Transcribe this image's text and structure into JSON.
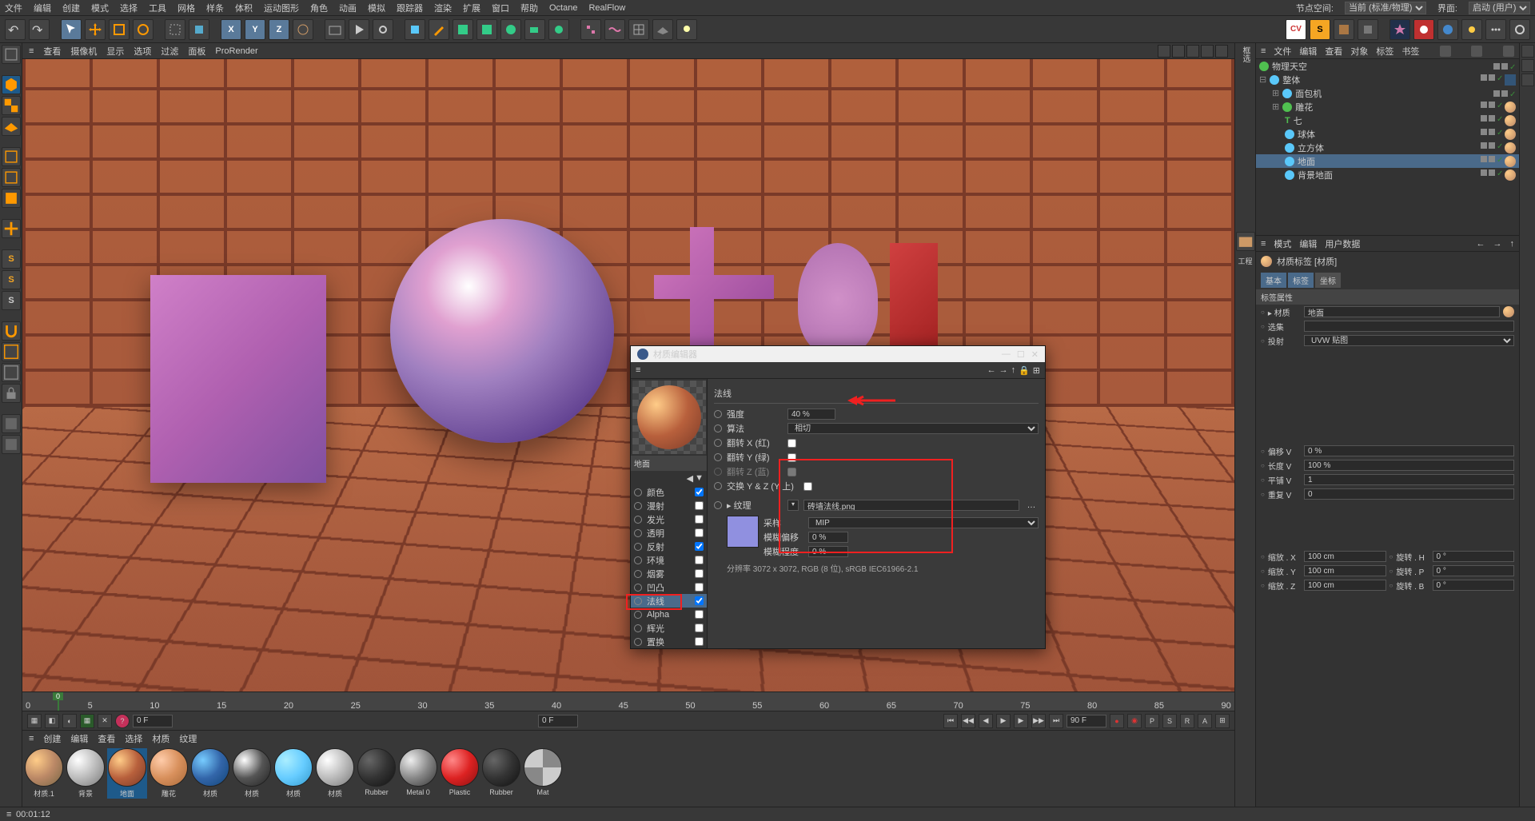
{
  "menubar": [
    "文件",
    "编辑",
    "创建",
    "模式",
    "选择",
    "工具",
    "网格",
    "样条",
    "体积",
    "运动图形",
    "角色",
    "动画",
    "模拟",
    "跟踪器",
    "渲染",
    "扩展",
    "窗口",
    "帮助",
    "Octane",
    "RealFlow"
  ],
  "menubar_right": {
    "node_space": "节点空间:",
    "node_space_val": "当前 (标准/物理)",
    "layout": "界面:",
    "layout_val": "启动 (用户)"
  },
  "vp_menu": [
    "≡",
    "查看",
    "摄像机",
    "显示",
    "选项",
    "过滤",
    "面板",
    "ProRender"
  ],
  "timeline": {
    "ticks": [
      "0",
      "5",
      "10",
      "15",
      "20",
      "25",
      "30",
      "35",
      "40",
      "45",
      "50",
      "55",
      "60",
      "65",
      "70",
      "75",
      "80",
      "85",
      "90"
    ]
  },
  "transport": {
    "start": "0 F",
    "cur": "0 F",
    "end": "90 F"
  },
  "mat_menu": [
    "≡",
    "创建",
    "编辑",
    "查看",
    "选择",
    "材质",
    "纹理"
  ],
  "materials": [
    {
      "name": "材质.1",
      "grad": "radial-gradient(circle at 30% 30%,#fc8,#b86,#764)"
    },
    {
      "name": "背景",
      "grad": "radial-gradient(circle at 30% 30%,#fff,#bbb,#777)"
    },
    {
      "name": "地面",
      "grad": "radial-gradient(circle at 30% 30%,#fc8,#b8603c,#7a3a28)",
      "sel": true
    },
    {
      "name": "雕花",
      "grad": "radial-gradient(circle at 30% 30%,#fca,#d8905c,#a86838)"
    },
    {
      "name": "材质",
      "grad": "radial-gradient(circle at 30% 30%,#7cf,#36a,#147)"
    },
    {
      "name": "材质",
      "grad": "radial-gradient(circle at 30% 30%,#fff,#555,#222)"
    },
    {
      "name": "材质",
      "grad": "radial-gradient(circle at 30% 30%,#aef,#6cf,#39c)"
    },
    {
      "name": "材质",
      "grad": "radial-gradient(circle at 30% 30%,#fff,#bbb,#777)"
    },
    {
      "name": "Rubber",
      "grad": "radial-gradient(circle at 30% 30%,#666,#333,#111)"
    },
    {
      "name": "Metal 0",
      "grad": "radial-gradient(circle at 30% 30%,#eee,#888,#333)"
    },
    {
      "name": "Plastic",
      "grad": "radial-gradient(circle at 30% 30%,#f88,#d22,#811)"
    },
    {
      "name": "Rubber",
      "grad": "radial-gradient(circle at 30% 30%,#666,#333,#111)"
    },
    {
      "name": "Mat",
      "grad": "repeating-conic-gradient(#888 0 25%,#ccc 0 50%)"
    }
  ],
  "objects_tabs": [
    "≡",
    "文件",
    "编辑",
    "查看",
    "对象",
    "标签",
    "书签"
  ],
  "tree": [
    {
      "ind": 0,
      "icon": "grn",
      "label": "物理天空",
      "tags": [
        "chk"
      ]
    },
    {
      "ind": 0,
      "icon": "blu",
      "label": "整体",
      "tags": [
        "chk",
        "spacer",
        "sq"
      ],
      "pre": "⊟ "
    },
    {
      "ind": 1,
      "icon": "blu",
      "label": "面包机",
      "tags": [
        "chk"
      ],
      "pre": "⊞ "
    },
    {
      "ind": 1,
      "icon": "grn",
      "label": "雕花",
      "tags": [
        "chk",
        "sph"
      ],
      "pre": "⊞ "
    },
    {
      "ind": 2,
      "icon": "txt",
      "label": "七",
      "tags": [
        "chk",
        "sph"
      ],
      "txt": "T"
    },
    {
      "ind": 2,
      "icon": "blu",
      "label": "球体",
      "tags": [
        "chk",
        "sph"
      ]
    },
    {
      "ind": 2,
      "icon": "blu",
      "label": "立方体",
      "tags": [
        "chk",
        "sph"
      ]
    },
    {
      "ind": 2,
      "icon": "blu",
      "label": "地面",
      "tags": [
        "chk",
        "sph2"
      ],
      "sel": true
    },
    {
      "ind": 2,
      "icon": "blu",
      "label": "背景地面",
      "tags": [
        "chk",
        "sph2"
      ]
    }
  ],
  "side_label": "框选",
  "project_label": "工程",
  "attr_head": [
    "≡",
    "模式",
    "编辑",
    "用户数据"
  ],
  "attr_title": "材质标签 [材质]",
  "attr_tabs": [
    {
      "l": "基本",
      "on": true
    },
    {
      "l": "标签",
      "on": true
    },
    {
      "l": "坐标",
      "on": false
    }
  ],
  "attr_section": "标签属性",
  "attr_rows": [
    {
      "l": "▸ 材质",
      "v": "地面",
      "trail": "ball"
    },
    {
      "l": "选集",
      "v": ""
    },
    {
      "l": "投射",
      "v": "UVW 贴图",
      "type": "select"
    }
  ],
  "attr_rows2": [
    {
      "l": "偏移 V",
      "v": "0 %"
    },
    {
      "l": "长度 V",
      "v": "100 %"
    },
    {
      "l": "平铺 V",
      "v": "1"
    },
    {
      "l": "重复 V",
      "v": "0"
    }
  ],
  "attr_rows3": [
    {
      "l": "缩放 . X",
      "v": "100 cm",
      "l2": "旋转 . H",
      "v2": "0 °"
    },
    {
      "l": "缩放 . Y",
      "v": "100 cm",
      "l2": "旋转 . P",
      "v2": "0 °"
    },
    {
      "l": "缩放 . Z",
      "v": "100 cm",
      "l2": "旋转 . B",
      "v2": "0 °"
    }
  ],
  "mat_editor": {
    "title": "材质编辑器",
    "name": "地面",
    "channels": [
      {
        "l": "颜色",
        "c": true
      },
      {
        "l": "漫射",
        "c": false
      },
      {
        "l": "发光",
        "c": false
      },
      {
        "l": "透明",
        "c": false
      },
      {
        "l": "反射",
        "c": true
      },
      {
        "l": "环境",
        "c": false
      },
      {
        "l": "烟雾",
        "c": false
      },
      {
        "l": "凹凸",
        "c": false
      },
      {
        "l": "法线",
        "c": true,
        "sel": true
      },
      {
        "l": "Alpha",
        "c": false
      },
      {
        "l": "辉光",
        "c": false
      },
      {
        "l": "置换",
        "c": false
      }
    ],
    "sec": "法线",
    "strength_l": "强度",
    "strength_v": "40 %",
    "algo_l": "算法",
    "algo_v": "相切",
    "flipx_l": "翻转 X (红)",
    "flipy_l": "翻转 Y (绿)",
    "flipz_l": "翻转 Z (蓝)",
    "swap_l": "交换 Y & Z (Y 上)",
    "tex_l": "▸ 纹理",
    "tex_v": "砖墙法线.png",
    "sample_l": "采样",
    "sample_v": "MIP",
    "bluroff_l": "模糊偏移",
    "bluroff_v": "0 %",
    "blurscl_l": "模糊程度",
    "blurscl_v": "0 %",
    "info": "分辨率 3072 x 3072, RGB (8 位), sRGB IEC61966-2.1"
  },
  "status": "00:01:12"
}
